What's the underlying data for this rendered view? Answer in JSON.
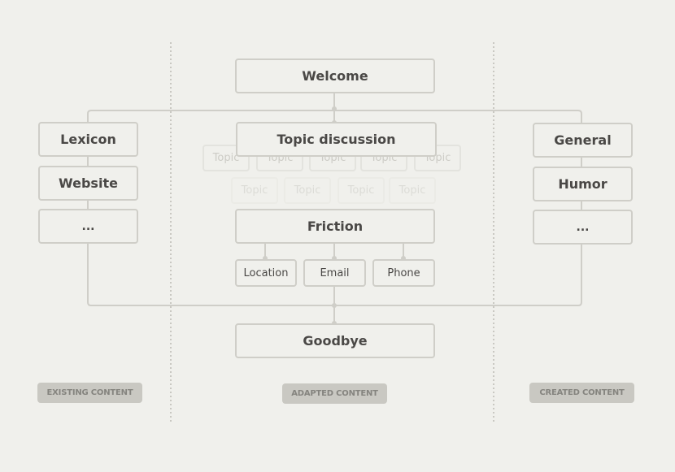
{
  "diagram": {
    "type": "flow",
    "colors": {
      "background": "#f0f0ec",
      "node_border": "#cfcec8",
      "connector": "#cfcec8",
      "text": "#4a4846",
      "label_bg": "#c9c8c2",
      "label_text": "#85847f"
    },
    "nodes": {
      "welcome": "Welcome",
      "topic_discussion": "Topic discussion",
      "friction": "Friction",
      "goodbye": "Goodbye",
      "friction_children": [
        "Location",
        "Email",
        "Phone"
      ],
      "topics_row1": [
        "Topic",
        "Topic",
        "Topic",
        "Topic",
        "Topic"
      ],
      "topics_row2": [
        "Topic",
        "Topic",
        "Topic",
        "Topic"
      ]
    },
    "left_column": {
      "items": [
        "Lexicon",
        "Website",
        "..."
      ],
      "label": "EXISTING CONTENT"
    },
    "center_column": {
      "label": "ADAPTED CONTENT"
    },
    "right_column": {
      "items": [
        "General",
        "Humor",
        "..."
      ],
      "label": "CREATED CONTENT"
    },
    "edges": [
      [
        "Welcome",
        "Lexicon"
      ],
      [
        "Welcome",
        "Topic discussion"
      ],
      [
        "Welcome",
        "General"
      ],
      [
        "Lexicon",
        "Website"
      ],
      [
        "Website",
        "..."
      ],
      [
        "General",
        "Humor"
      ],
      [
        "Humor",
        "..."
      ],
      [
        "Friction",
        "Location"
      ],
      [
        "Friction",
        "Email"
      ],
      [
        "Friction",
        "Phone"
      ],
      [
        "Email",
        "Goodbye"
      ],
      [
        "...",
        "Goodbye"
      ]
    ]
  }
}
